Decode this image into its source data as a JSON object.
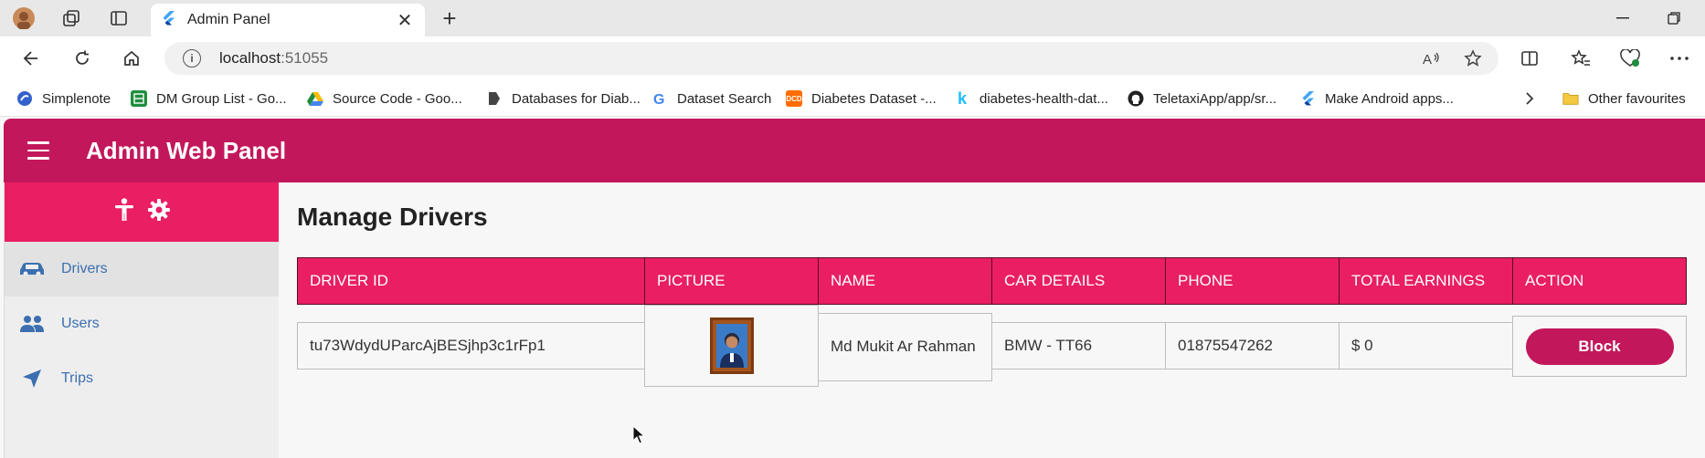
{
  "browser": {
    "tab_title": "Admin Panel",
    "url_host": "localhost",
    "url_port": ":51055",
    "bookmarks": [
      {
        "label": "Simplenote",
        "icon": "simplenote-icon",
        "color": "#3361cc"
      },
      {
        "label": "DM Group List - Go...",
        "icon": "sheets-icon",
        "color": "#1e8e3e"
      },
      {
        "label": "Source Code - Goo...",
        "icon": "drive-icon",
        "color": "#fbbc04"
      },
      {
        "label": "Databases for Diab...",
        "icon": "bookmark-icon",
        "color": "#444444"
      },
      {
        "label": "Dataset Search",
        "icon": "google-icon",
        "color": "#4285f4"
      },
      {
        "label": "Diabetes Dataset -...",
        "icon": "dcd-icon",
        "color": "#ff6d00"
      },
      {
        "label": "diabetes-health-dat...",
        "icon": "kaggle-icon",
        "color": "#20beff"
      },
      {
        "label": "TeletaxiApp/app/sr...",
        "icon": "github-icon",
        "color": "#222222"
      },
      {
        "label": "Make Android apps...",
        "icon": "flutter-icon",
        "color": "#42a5f5"
      }
    ],
    "other_favourites": "Other favourites"
  },
  "app": {
    "title": "Admin Web Panel",
    "colors": {
      "primary": "#c2185b",
      "accent": "#e91e63",
      "link": "#3b6fb0"
    },
    "sidebar": [
      {
        "label": "Drivers",
        "icon": "car-icon",
        "active": true
      },
      {
        "label": "Users",
        "icon": "users-icon",
        "active": false
      },
      {
        "label": "Trips",
        "icon": "navigation-icon",
        "active": false
      }
    ],
    "page_title": "Manage Drivers",
    "table": {
      "headers": [
        "DRIVER ID",
        "PICTURE",
        "NAME",
        "CAR DETAILS",
        "PHONE",
        "TOTAL EARNINGS",
        "ACTION"
      ],
      "rows": [
        {
          "driver_id": "tu73WdydUParcAjBESjhp3c1rFp1",
          "name": "Md Mukit Ar Rahman",
          "car": "BMW - TT66",
          "phone": "01875547262",
          "earnings": "$ 0",
          "action": "Block"
        }
      ]
    }
  }
}
